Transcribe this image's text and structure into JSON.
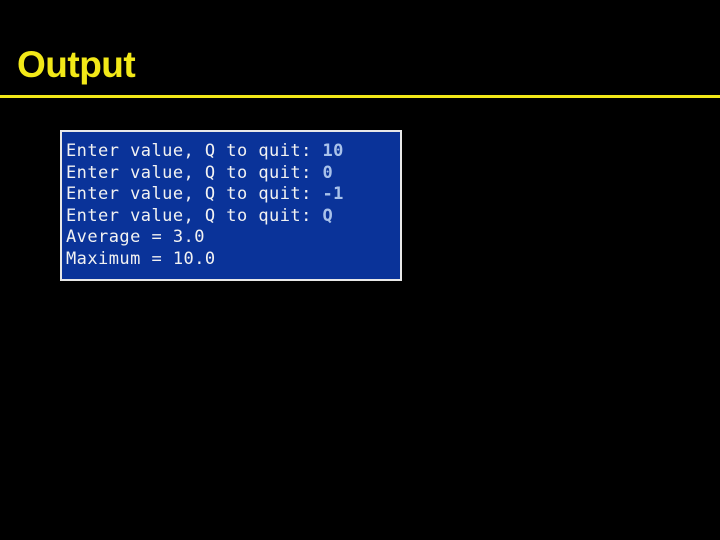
{
  "slide": {
    "title": "Output",
    "background_color": "#000000",
    "accent_color": "#f2e818"
  },
  "console": {
    "background_color": "#0a3399",
    "border_color": "#e8e8e8",
    "prompt_text_color": "#f2f2f2",
    "entry_text_color": "#a9c2ea",
    "lines": [
      {
        "prompt": "Enter value, Q to quit: ",
        "entry": "10"
      },
      {
        "prompt": "Enter value, Q to quit: ",
        "entry": "0"
      },
      {
        "prompt": "Enter value, Q to quit: ",
        "entry": "-1"
      },
      {
        "prompt": "Enter value, Q to quit: ",
        "entry": "Q"
      },
      {
        "prompt": "Average = 3.0",
        "entry": ""
      },
      {
        "prompt": "Maximum = 10.0",
        "entry": ""
      }
    ]
  }
}
